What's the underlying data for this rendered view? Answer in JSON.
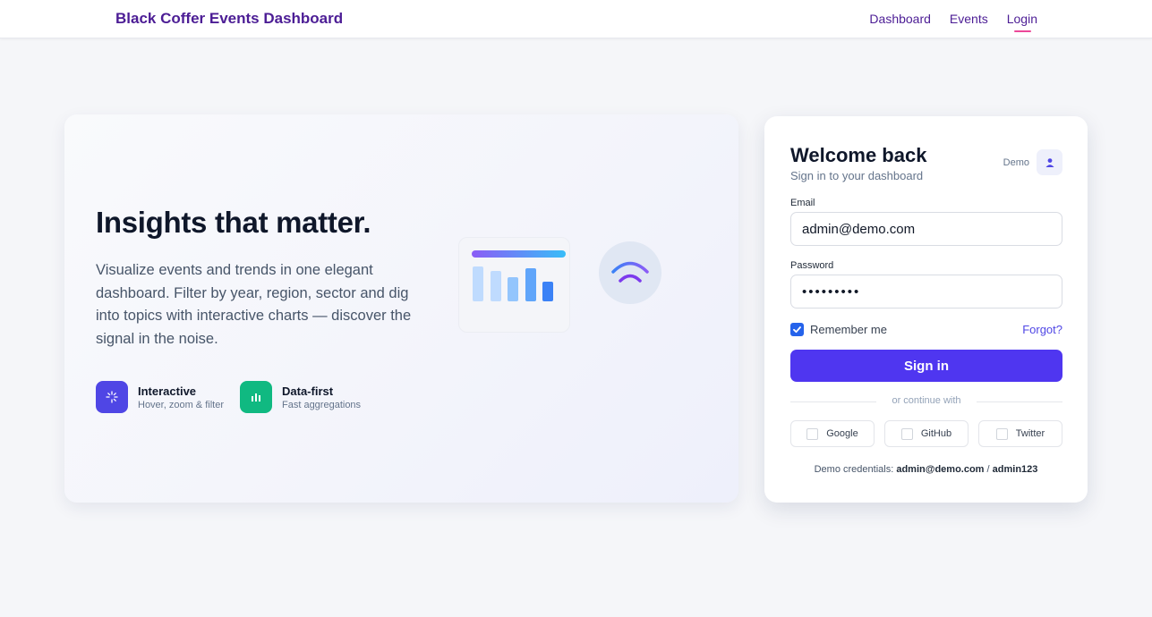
{
  "header": {
    "brand": "Black Coffer Events Dashboard",
    "nav": [
      {
        "label": "Dashboard"
      },
      {
        "label": "Events"
      },
      {
        "label": "Login",
        "active": true
      }
    ]
  },
  "hero": {
    "title": "Insights that matter.",
    "description": "Visualize events and trends in one elegant dashboard. Filter by year, region, sector and dig into topics with interactive charts — discover the signal in the noise.",
    "features": [
      {
        "title": "Interactive",
        "subtitle": "Hover, zoom & filter",
        "icon": "sparkle-icon",
        "color": "#4f46e5"
      },
      {
        "title": "Data-first",
        "subtitle": "Fast aggregations",
        "icon": "bar-chart-icon",
        "color": "#10b981"
      }
    ],
    "illustration": {
      "bars": [
        0.75,
        0.66,
        0.52,
        0.72,
        0.42
      ],
      "bar_colors": [
        "#bfdbfe",
        "#bfdbfe",
        "#93c5fd",
        "#60a5fa",
        "#3b82f6"
      ],
      "wifi_icon": "wifi-icon"
    }
  },
  "login": {
    "title": "Welcome back",
    "subtitle": "Sign in to your dashboard",
    "demo_label": "Demo",
    "demo_icon": "user-icon",
    "email_label": "Email",
    "email_value": "admin@demo.com",
    "password_label": "Password",
    "password_value": "•••••••••",
    "remember_label": "Remember me",
    "remember_checked": true,
    "forgot_label": "Forgot?",
    "signin_label": "Sign in",
    "divider_text": "or continue with",
    "social": [
      {
        "label": "Google"
      },
      {
        "label": "GitHub"
      },
      {
        "label": "Twitter"
      }
    ],
    "creds_prefix": "Demo credentials: ",
    "creds_email": "admin@demo.com",
    "creds_sep": " / ",
    "creds_password": "admin123"
  },
  "colors": {
    "brand": "#4c1d95",
    "accent": "#4f36f0",
    "nav_active_underline": "#ec4899"
  }
}
